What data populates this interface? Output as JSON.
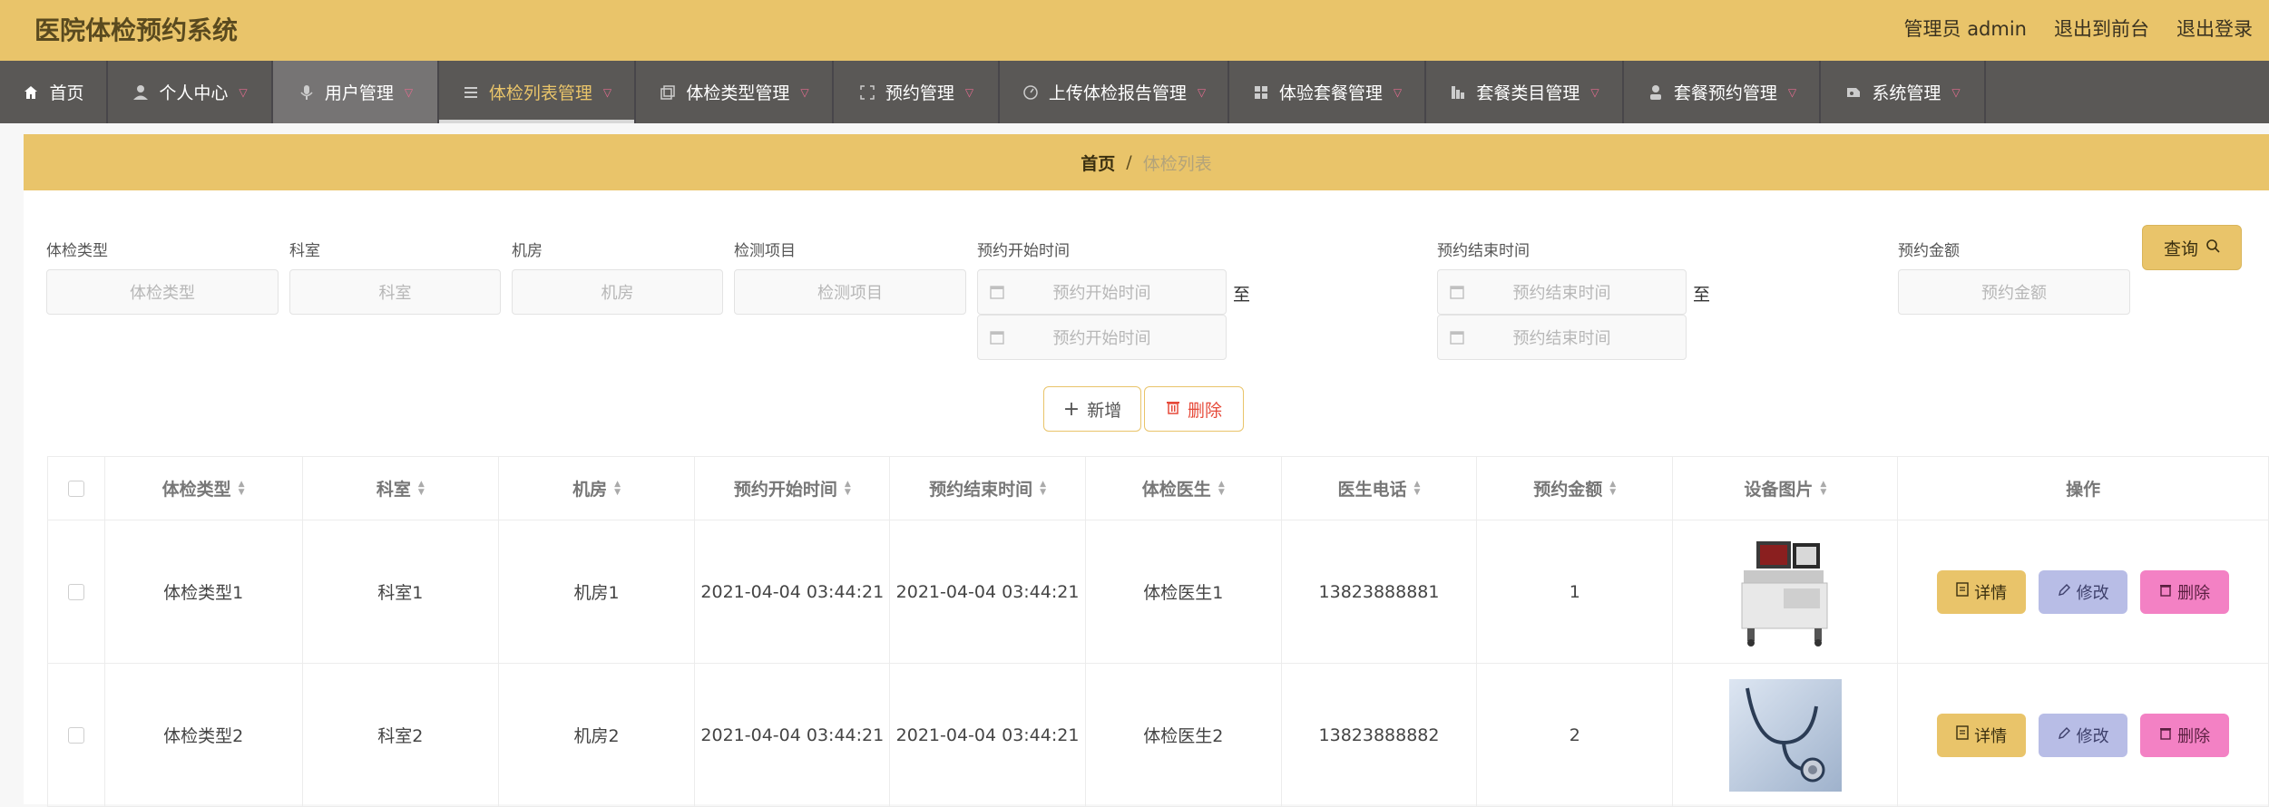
{
  "header": {
    "title": "医院体检预约系统",
    "admin_label": "管理员 admin",
    "to_front": "退出到前台",
    "logout": "退出登录"
  },
  "nav": [
    {
      "label": "首页",
      "icon": "home-icon",
      "caret": false
    },
    {
      "label": "个人中心",
      "icon": "user-icon",
      "caret": true
    },
    {
      "label": "用户管理",
      "icon": "mic-icon",
      "caret": true
    },
    {
      "label": "体检列表管理",
      "icon": "list-icon",
      "caret": true
    },
    {
      "label": "体检类型管理",
      "icon": "copy-icon",
      "caret": true
    },
    {
      "label": "预约管理",
      "icon": "scan-icon",
      "caret": true
    },
    {
      "label": "上传体检报告管理",
      "icon": "gauge-icon",
      "caret": true
    },
    {
      "label": "体验套餐管理",
      "icon": "grid-icon",
      "caret": true
    },
    {
      "label": "套餐类目管理",
      "icon": "chart-icon",
      "caret": true
    },
    {
      "label": "套餐预约管理",
      "icon": "person-icon",
      "caret": true
    },
    {
      "label": "系统管理",
      "icon": "settings-icon",
      "caret": true
    }
  ],
  "breadcrumb": {
    "home": "首页",
    "sep": "/",
    "current": "体检列表"
  },
  "filters": {
    "type": {
      "label": "体检类型",
      "placeholder": "体检类型"
    },
    "dept": {
      "label": "科室",
      "placeholder": "科室"
    },
    "room": {
      "label": "机房",
      "placeholder": "机房"
    },
    "item": {
      "label": "检测项目",
      "placeholder": "检测项目"
    },
    "start": {
      "label": "预约开始时间",
      "placeholder": "预约开始时间"
    },
    "end": {
      "label": "预约结束时间",
      "placeholder": "预约结束时间"
    },
    "amount": {
      "label": "预约金额",
      "placeholder": "预约金额"
    },
    "to": "至",
    "query_btn": "查询"
  },
  "actions": {
    "add": "新增",
    "delete": "删除"
  },
  "table": {
    "columns": [
      "体检类型",
      "科室",
      "机房",
      "预约开始时间",
      "预约结束时间",
      "体检医生",
      "医生电话",
      "预约金额",
      "设备图片",
      "操作"
    ],
    "rows": [
      {
        "type": "体检类型1",
        "dept": "科室1",
        "room": "机房1",
        "start": "2021-04-04 03:44:21",
        "end": "2021-04-04 03:44:21",
        "doctor": "体检医生1",
        "phone": "13823888881",
        "amount": "1"
      },
      {
        "type": "体检类型2",
        "dept": "科室2",
        "room": "机房2",
        "start": "2021-04-04 03:44:21",
        "end": "2021-04-04 03:44:21",
        "doctor": "体检医生2",
        "phone": "13823888882",
        "amount": "2"
      }
    ],
    "ops": {
      "detail": "详情",
      "edit": "修改",
      "delete": "删除"
    }
  },
  "colors": {
    "accent": "#e9c46a",
    "nav_bg": "#5a5856",
    "edit": "#b8bde6",
    "delete": "#f381c4"
  }
}
